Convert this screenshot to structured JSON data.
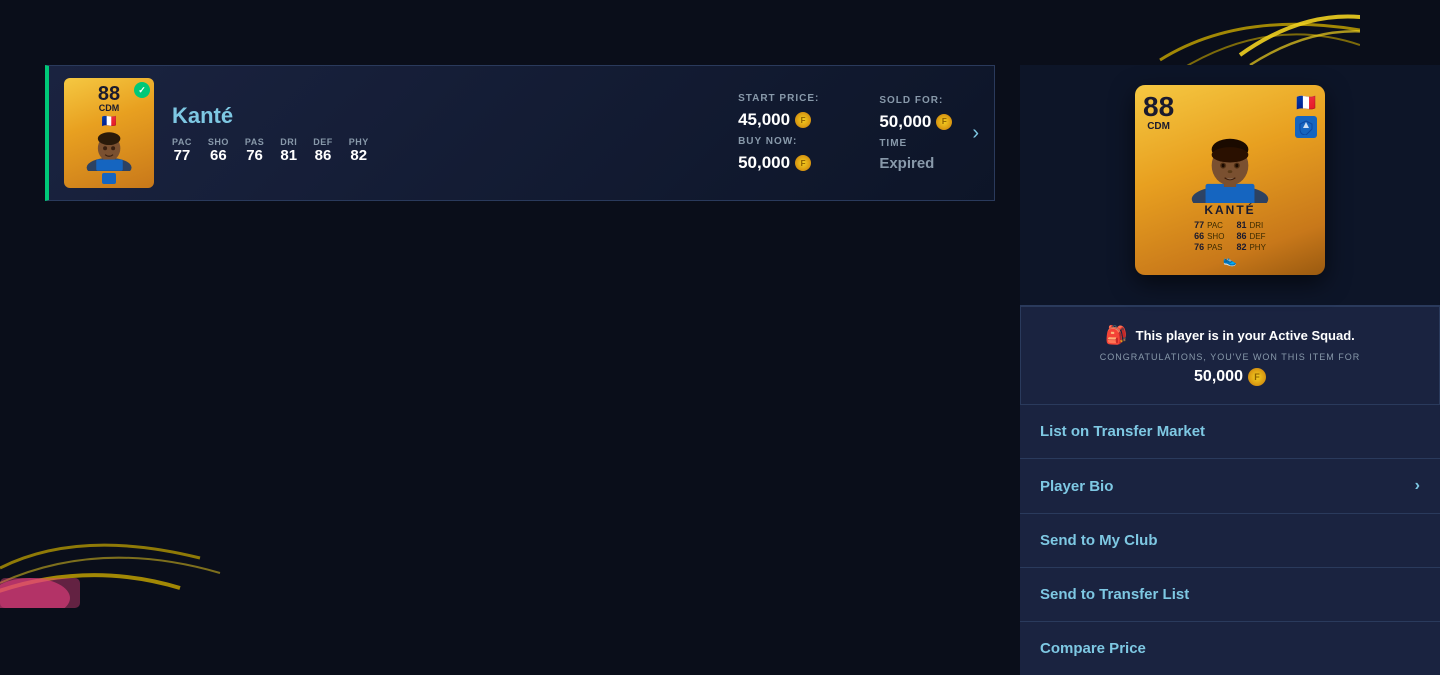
{
  "player": {
    "name": "Kanté",
    "rating": "88",
    "position": "CDM",
    "pac": "77",
    "sho": "66",
    "pas": "76",
    "dri": "81",
    "def": "86",
    "phy": "82"
  },
  "auction": {
    "start_price_label": "START PRICE:",
    "start_price_value": "45,000",
    "buy_now_label": "BUY NOW:",
    "buy_now_value": "50,000",
    "sold_for_label": "SOLD FOR:",
    "sold_for_value": "50,000",
    "time_label": "TIME",
    "time_value": "Expired"
  },
  "notice": {
    "icon": "🎒",
    "main_text": "This player is in your Active Squad.",
    "sub_text": "CONGRATULATIONS, YOU'VE WON THIS ITEM FOR",
    "price": "50,000"
  },
  "actions": {
    "list_market": "List on Transfer Market",
    "player_bio": "Player Bio",
    "send_my_club": "Send to My Club",
    "send_transfer_list": "Send to Transfer List",
    "compare_price": "Compare Price"
  }
}
